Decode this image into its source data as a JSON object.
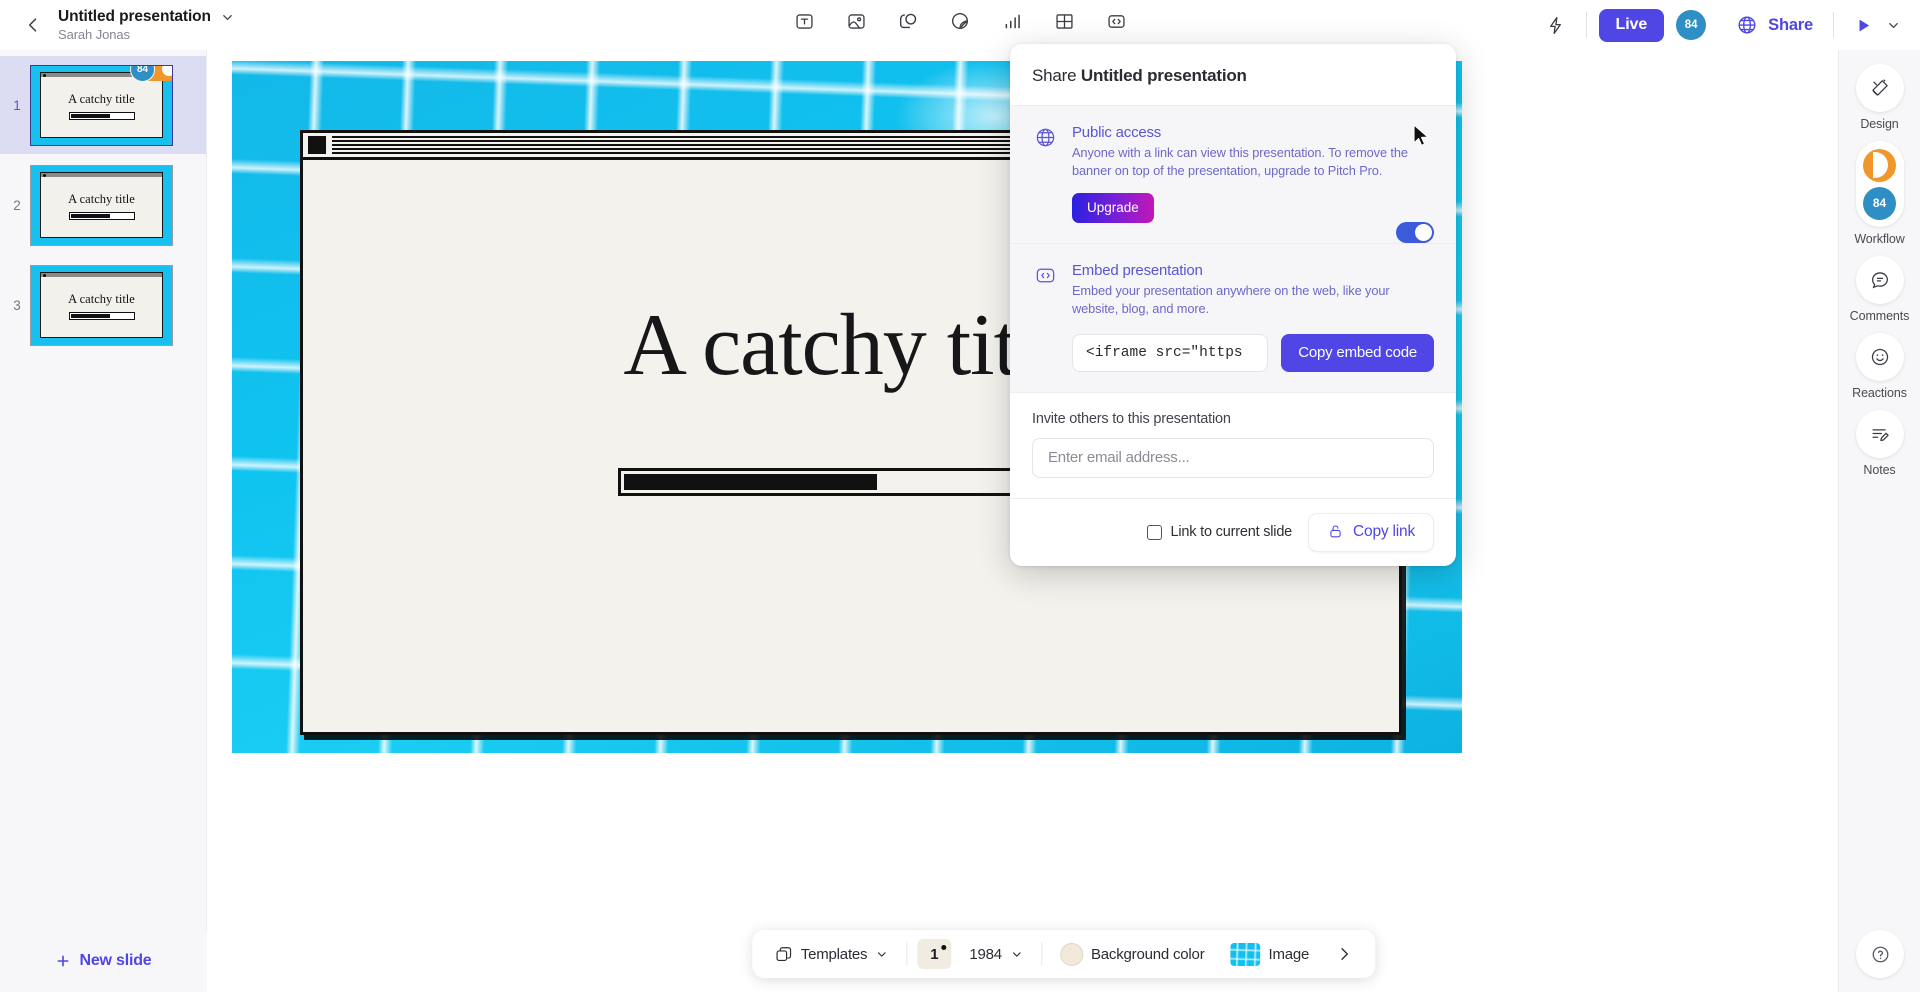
{
  "topbar": {
    "back_icon": "chevron-left-icon",
    "doc_title": "Untitled presentation",
    "doc_author": "Sarah Jonas",
    "title_chevron_icon": "chevron-down-icon",
    "tools": [
      {
        "name": "text-tool",
        "icon": "text-box-icon"
      },
      {
        "name": "image-tool",
        "icon": "image-icon"
      },
      {
        "name": "shape-tool",
        "icon": "shapes-icon"
      },
      {
        "name": "sticker-tool",
        "icon": "sticker-icon"
      },
      {
        "name": "chart-tool",
        "icon": "bar-chart-icon"
      },
      {
        "name": "table-tool",
        "icon": "table-icon"
      },
      {
        "name": "embed-tool",
        "icon": "code-embed-icon"
      }
    ],
    "bolt_icon": "lightning-bolt-icon",
    "live_label": "Live",
    "live_count": "84",
    "share_label": "Share",
    "share_icon": "globe-icon",
    "play_icon": "play-icon",
    "play_chevron_icon": "chevron-down-icon"
  },
  "slides": {
    "items": [
      {
        "number": "1",
        "title": "A catchy title",
        "active": true,
        "workflow_count": "84"
      },
      {
        "number": "2",
        "title": "A catchy title",
        "active": false
      },
      {
        "number": "3",
        "title": "A catchy title",
        "active": false
      }
    ],
    "new_slide_label": "New slide",
    "new_slide_icon": "plus-icon"
  },
  "canvas": {
    "slide_title": "A catchy title"
  },
  "bottom_bar": {
    "templates_label": "Templates",
    "templates_icon": "layers-icon",
    "templates_chevron_icon": "chevron-down-icon",
    "page_number": "1",
    "theme_name": "1984",
    "theme_chevron_icon": "chevron-down-icon",
    "background_color_label": "Background color",
    "background_color_hex": "#f1e9da",
    "image_label": "Image",
    "next_icon": "chevron-right-icon"
  },
  "right_rail": {
    "items": [
      {
        "label": "Design",
        "icon": "design-brush-icon"
      },
      {
        "label": "Workflow",
        "icon": "workflow-status-icon",
        "badge": "84"
      },
      {
        "label": "Comments",
        "icon": "comment-icon"
      },
      {
        "label": "Reactions",
        "icon": "smiley-icon"
      },
      {
        "label": "Notes",
        "icon": "notes-edit-icon"
      }
    ],
    "help_icon": "question-mark-icon"
  },
  "share_dialog": {
    "header_prefix": "Share",
    "header_title": "Untitled presentation",
    "public_access": {
      "icon": "globe-icon",
      "title": "Public access",
      "description": "Anyone with a link can view this presentation. To remove the banner on top of the presentation, upgrade to Pitch Pro.",
      "upgrade_label": "Upgrade",
      "toggle_on": "true"
    },
    "embed": {
      "icon": "code-embed-icon",
      "title": "Embed presentation",
      "description": "Embed your presentation anywhere on the web, like your website, blog, and more.",
      "code_value": "<iframe src=\"https",
      "copy_button_label": "Copy embed code"
    },
    "invite": {
      "label": "Invite others to this presentation",
      "placeholder": "Enter email address..."
    },
    "footer": {
      "checkbox_label": "Link to current slide",
      "copy_link_label": "Copy link",
      "lock_icon": "unlocked-padlock-icon"
    }
  },
  "colors": {
    "accent": "#4f46e5",
    "live_badge": "#2f8fc4",
    "workflow_orange": "#f0962a",
    "toggle_on": "#3b5bdb"
  }
}
